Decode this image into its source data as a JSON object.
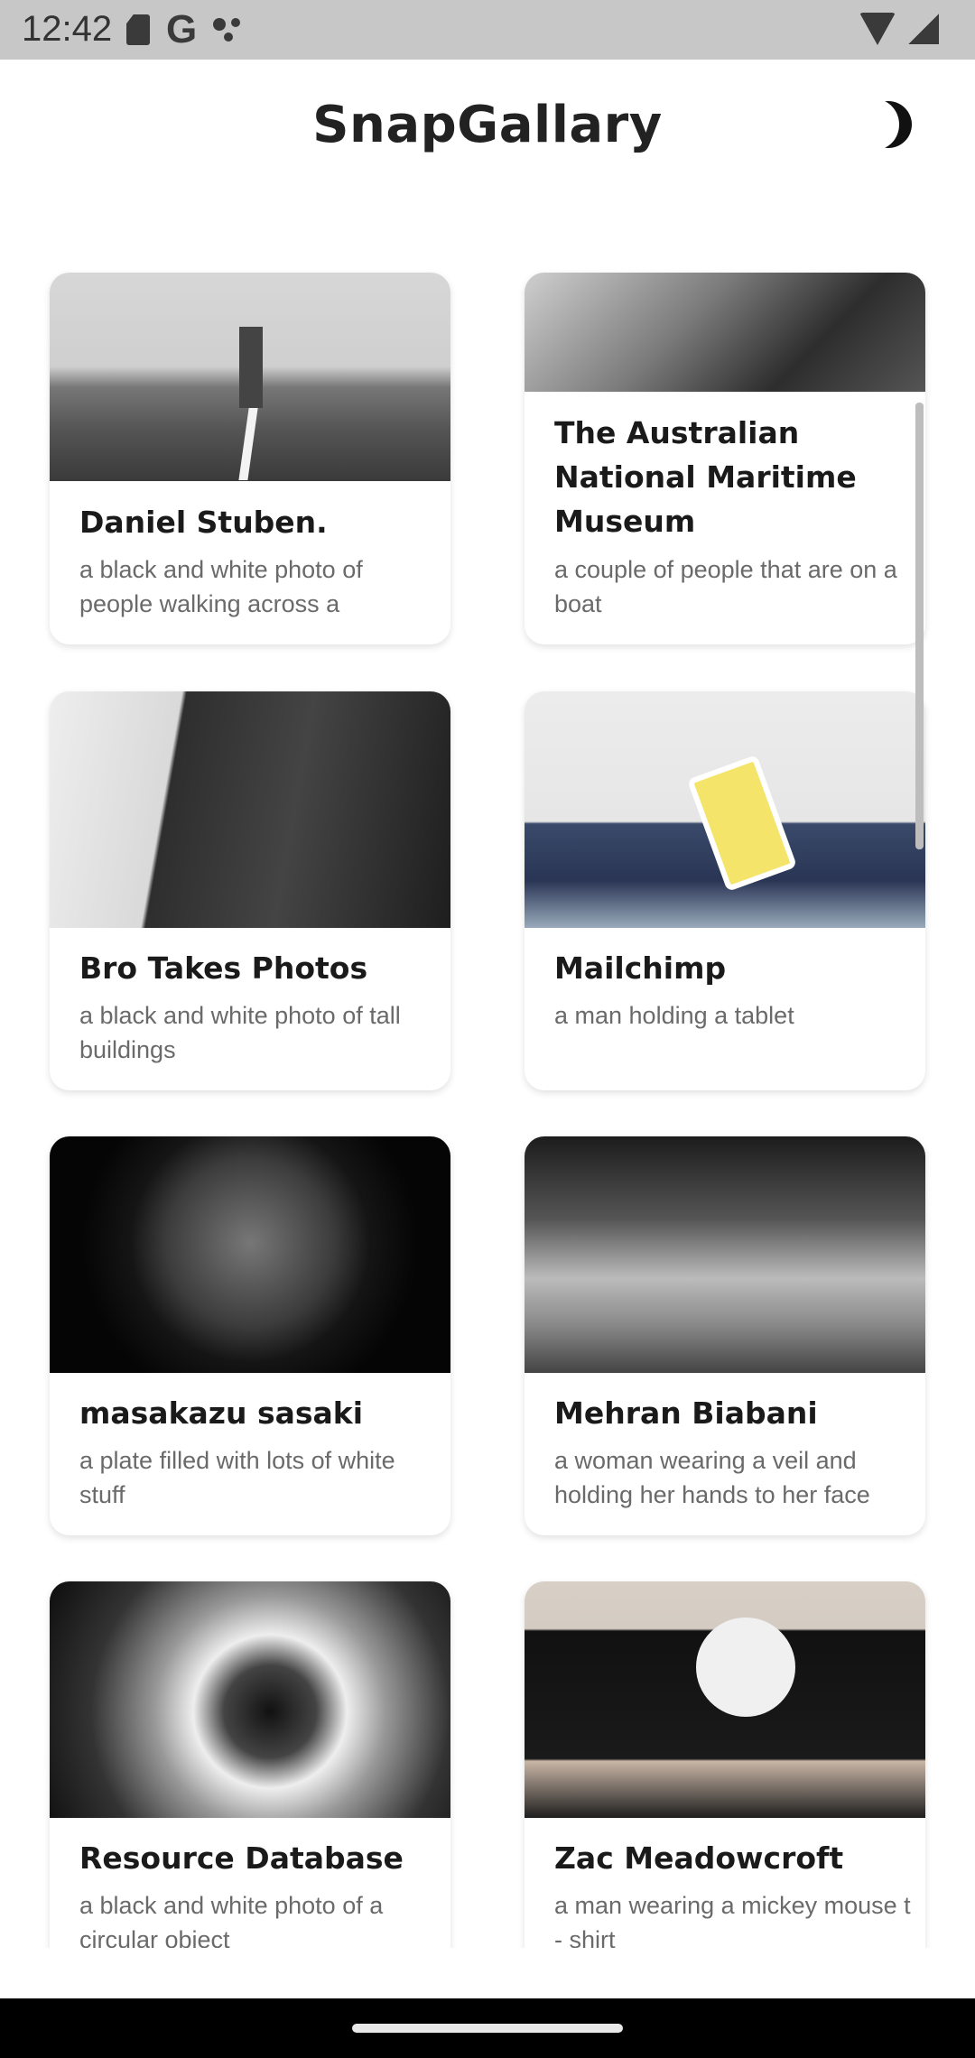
{
  "status_bar": {
    "time": "12:42"
  },
  "app": {
    "title": "SnapGallary"
  },
  "cards": [
    {
      "title": "Daniel Stuben.",
      "description": "a black and white photo of people walking across a"
    },
    {
      "title": "The Australian National Maritime Museum",
      "description": "a couple of people that are on a boat"
    },
    {
      "title": "Bro Takes Photos",
      "description": "a black and white photo of tall buildings"
    },
    {
      "title": "Mailchimp",
      "description": "a man holding a tablet"
    },
    {
      "title": "masakazu sasaki",
      "description": "a plate filled with lots of white stuff"
    },
    {
      "title": "Mehran Biabani",
      "description": "a woman wearing a veil and holding her hands to her face"
    },
    {
      "title": "Resource Database",
      "description": "a black and white photo of a circular object"
    },
    {
      "title": "Zac Meadowcroft",
      "description": "a man wearing a mickey mouse t - shirt"
    }
  ]
}
